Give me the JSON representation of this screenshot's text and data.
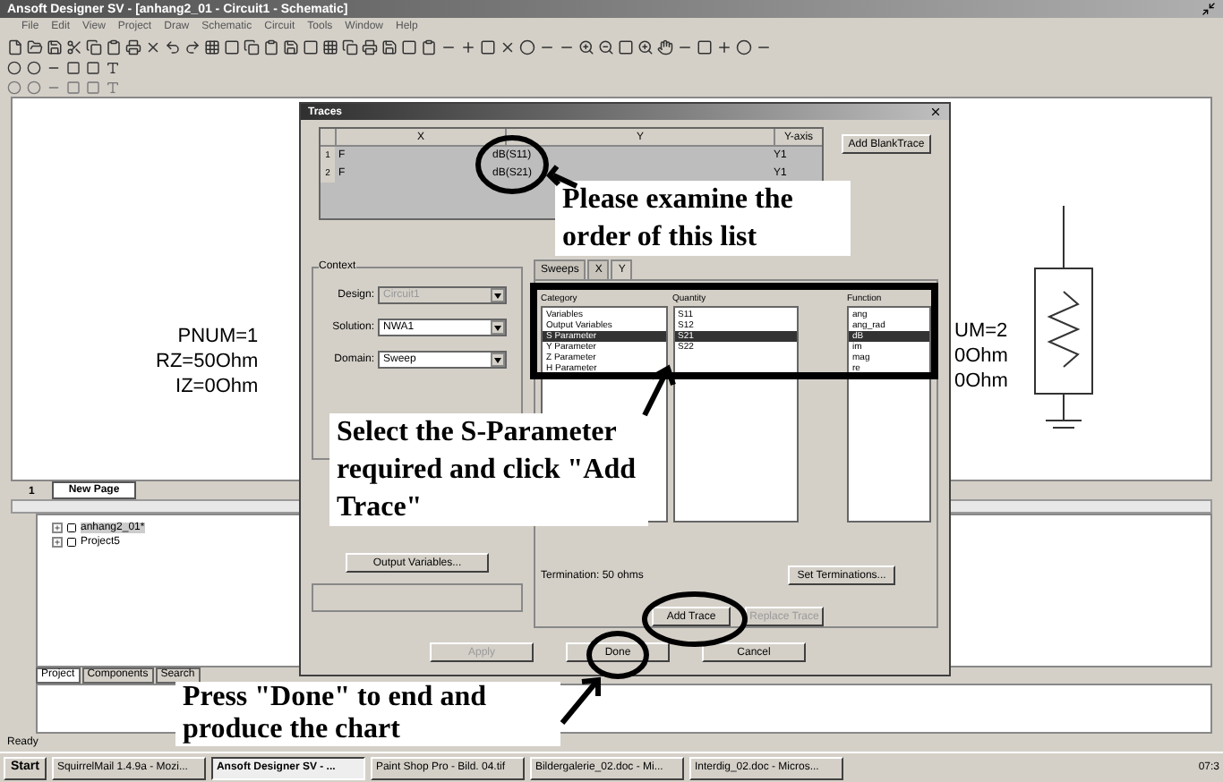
{
  "window": {
    "title": "Ansoft Designer SV - [anhang2_01 - Circuit1 - Schematic]"
  },
  "menu": [
    "File",
    "Edit",
    "View",
    "Project",
    "Draw",
    "Schematic",
    "Circuit",
    "Tools",
    "Window",
    "Help"
  ],
  "schematic": {
    "port_left": [
      "PNUM=1",
      "RZ=50Ohm",
      "IZ=0Ohm"
    ],
    "port_right": [
      "UM=2",
      "0Ohm",
      "0Ohm"
    ]
  },
  "page_tabs": [
    {
      "label": "1",
      "selected": false
    },
    {
      "label": "New Page",
      "selected": true
    }
  ],
  "project_tree": [
    {
      "label": "anhang2_01*",
      "selected": true
    },
    {
      "label": "Project5",
      "selected": false
    }
  ],
  "project_tabs": [
    {
      "label": "Project",
      "selected": true
    },
    {
      "label": "Components",
      "selected": false
    },
    {
      "label": "Search",
      "selected": false
    }
  ],
  "status_bar": "Ready",
  "taskbar": {
    "start": "Start",
    "items": [
      {
        "label": "SquirrelMail 1.4.9a - Mozi...",
        "selected": false
      },
      {
        "label": "Ansoft Designer SV - ...",
        "selected": true
      },
      {
        "label": "Paint Shop Pro - Bild. 04.tif",
        "selected": false
      },
      {
        "label": "Bildergalerie_02.doc - Mi...",
        "selected": false
      },
      {
        "label": "Interdig_02.doc - Micros...",
        "selected": false
      }
    ],
    "clock": "07:3"
  },
  "dialog": {
    "title": "Traces",
    "table": {
      "columns": [
        "X",
        "Y",
        "Y-axis"
      ],
      "rows": [
        {
          "index": "1",
          "x": "F",
          "y": "dB(S11)",
          "axis": "Y1"
        },
        {
          "index": "2",
          "x": "F",
          "y": "dB(S21)",
          "axis": "Y1"
        }
      ]
    },
    "add_blank_trace": "Add BlankTrace",
    "context": {
      "title": "Context",
      "fields": [
        {
          "label": "Design:",
          "value": "Circuit1",
          "disabled": true
        },
        {
          "label": "Solution:",
          "value": "NWA1",
          "disabled": false
        },
        {
          "label": "Domain:",
          "value": "Sweep",
          "disabled": false
        }
      ]
    },
    "output_variables": "Output Variables...",
    "tabs": [
      {
        "label": "Sweeps",
        "selected": false
      },
      {
        "label": "X",
        "selected": false
      },
      {
        "label": "Y",
        "selected": true
      }
    ],
    "lists": [
      {
        "title": "Category",
        "items": [
          {
            "label": "Variables",
            "selected": false
          },
          {
            "label": "Output Variables",
            "selected": false
          },
          {
            "label": "S Parameter",
            "selected": true
          },
          {
            "label": "Y Parameter",
            "selected": false
          },
          {
            "label": "Z Parameter",
            "selected": false
          },
          {
            "label": "H Parameter",
            "selected": false
          }
        ]
      },
      {
        "title": "Quantity",
        "items": [
          {
            "label": "S11",
            "selected": false
          },
          {
            "label": "S12",
            "selected": false
          },
          {
            "label": "S21",
            "selected": true
          },
          {
            "label": "S22",
            "selected": false
          }
        ]
      },
      {
        "title": "Function",
        "items": [
          {
            "label": "ang",
            "selected": false
          },
          {
            "label": "ang_rad",
            "selected": false
          },
          {
            "label": "dB",
            "selected": true
          },
          {
            "label": "im",
            "selected": false
          },
          {
            "label": "mag",
            "selected": false
          },
          {
            "label": "re",
            "selected": false
          }
        ]
      }
    ],
    "termination": "Termination:  50 ohms",
    "set_terminations": "Set Terminations...",
    "trace_buttons": [
      {
        "label": "Add Trace",
        "disabled": false
      },
      {
        "label": "Replace Trace",
        "disabled": true
      }
    ],
    "buttons": [
      {
        "label": "Apply",
        "disabled": true
      },
      {
        "label": "Done",
        "disabled": false
      },
      {
        "label": "Cancel",
        "disabled": false
      }
    ]
  },
  "annotations": [
    "Please examine the order of this list",
    "Select the S-Parameter required and click \"Add Trace\"",
    "Press \"Done\" to end and produce the chart"
  ]
}
